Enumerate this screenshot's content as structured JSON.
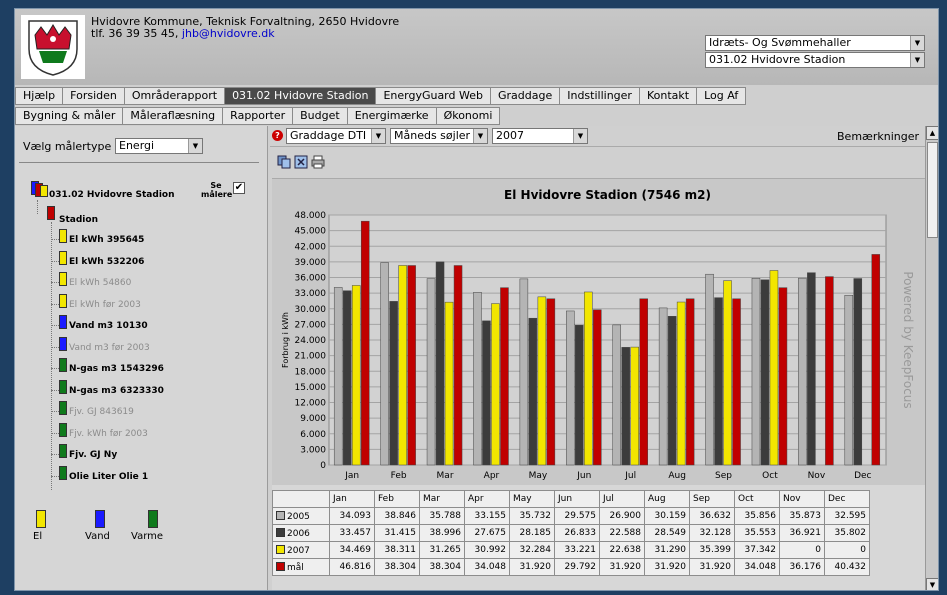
{
  "header": {
    "line1": "Hvidovre Kommune, Teknisk Forvaltning, 2650 Hvidovre",
    "phone": "tlf. 36 39 35 45,",
    "email": "jhb@hvidovre.dk",
    "select_category": "Idræts- Og Svømmehaller",
    "select_building": "031.02 Hvidovre Stadion"
  },
  "nav_main": [
    "Hjælp",
    "Forsiden",
    "Områderapport",
    "031.02 Hvidovre Stadion",
    "EnergyGuard Web",
    "Graddage",
    "Indstillinger",
    "Kontakt",
    "Log Af"
  ],
  "nav_sub": [
    "Bygning & måler",
    "Måleraflæsning",
    "Rapporter",
    "Budget",
    "Energimærke",
    "Økonomi"
  ],
  "left": {
    "malertype_label": "Vælg målertype",
    "malertype_value": "Energi",
    "se_malere": "Se målere",
    "root": "031.02 Hvidovre Stadion",
    "group": "Stadion",
    "meters": [
      {
        "label": "El kWh 395645",
        "color": "#f2e600",
        "dim": false
      },
      {
        "label": "El kWh 532206",
        "color": "#f2e600",
        "dim": false
      },
      {
        "label": "El kWh 54860",
        "color": "#f2e600",
        "dim": true
      },
      {
        "label": "El kWh før 2003",
        "color": "#f2e600",
        "dim": true
      },
      {
        "label": "Vand m3 10130",
        "color": "#1a1aff",
        "dim": false
      },
      {
        "label": "Vand m3 før 2003",
        "color": "#1a1aff",
        "dim": true
      },
      {
        "label": "N-gas m3 1543296",
        "color": "#0f7a1c",
        "dim": false
      },
      {
        "label": "N-gas m3 6323330",
        "color": "#0f7a1c",
        "dim": false
      },
      {
        "label": "Fjv. GJ 843619",
        "color": "#0f7a1c",
        "dim": true
      },
      {
        "label": "Fjv. kWh før 2003",
        "color": "#0f7a1c",
        "dim": true
      },
      {
        "label": "Fjv. GJ Ny",
        "color": "#0f7a1c",
        "dim": false
      },
      {
        "label": "Olie Liter Olie 1",
        "color": "#0f7a1c",
        "dim": false
      }
    ],
    "legend": [
      {
        "label": "El",
        "color": "#f2e600"
      },
      {
        "label": "Vand",
        "color": "#1a1aff"
      },
      {
        "label": "Varme",
        "color": "#0f7a1c"
      }
    ]
  },
  "toolbar": {
    "sel_graddage": "Graddage DTI",
    "sel_view": "Måneds søjler",
    "sel_year": "2007",
    "remarks": "Bemærkninger"
  },
  "watermark": "Powered by KeepFocus",
  "chart_data": {
    "type": "bar",
    "title": "El Hvidovre Stadion (7546 m2)",
    "ylabel": "Forbrug i kWh",
    "ylim": [
      0,
      48000
    ],
    "yticks": [
      "0",
      "3.000",
      "6.000",
      "9.000",
      "12.000",
      "15.000",
      "18.000",
      "21.000",
      "24.000",
      "27.000",
      "30.000",
      "33.000",
      "36.000",
      "39.000",
      "42.000",
      "45.000",
      "48.000"
    ],
    "categories": [
      "Jan",
      "Feb",
      "Mar",
      "Apr",
      "May",
      "Jun",
      "Jul",
      "Aug",
      "Sep",
      "Oct",
      "Nov",
      "Dec"
    ],
    "series": [
      {
        "name": "2005",
        "color": "#b4b4b4",
        "values": [
          34093,
          38846,
          35788,
          33155,
          35732,
          29575,
          26900,
          30159,
          36632,
          35856,
          35873,
          32595
        ],
        "labels": [
          "34.093",
          "38.846",
          "35.788",
          "33.155",
          "35.732",
          "29.575",
          "26.900",
          "30.159",
          "36.632",
          "35.856",
          "35.873",
          "32.595"
        ]
      },
      {
        "name": "2006",
        "color": "#3c3c3c",
        "values": [
          33457,
          31415,
          38996,
          27675,
          28185,
          26833,
          22588,
          28549,
          32128,
          35553,
          36921,
          35802
        ],
        "labels": [
          "33.457",
          "31.415",
          "38.996",
          "27.675",
          "28.185",
          "26.833",
          "22.588",
          "28.549",
          "32.128",
          "35.553",
          "36.921",
          "35.802"
        ]
      },
      {
        "name": "2007",
        "color": "#f2e600",
        "values": [
          34469,
          38311,
          31265,
          30992,
          32284,
          33221,
          22638,
          31290,
          35399,
          37342,
          0,
          0
        ],
        "labels": [
          "34.469",
          "38.311",
          "31.265",
          "30.992",
          "32.284",
          "33.221",
          "22.638",
          "31.290",
          "35.399",
          "37.342",
          "0",
          "0"
        ]
      },
      {
        "name": "mål",
        "color": "#c00000",
        "values": [
          46816,
          38304,
          38304,
          34048,
          31920,
          29792,
          31920,
          31920,
          31920,
          34048,
          36176,
          40432
        ],
        "labels": [
          "46.816",
          "38.304",
          "38.304",
          "34.048",
          "31.920",
          "29.792",
          "31.920",
          "31.920",
          "31.920",
          "34.048",
          "36.176",
          "40.432"
        ]
      }
    ]
  }
}
